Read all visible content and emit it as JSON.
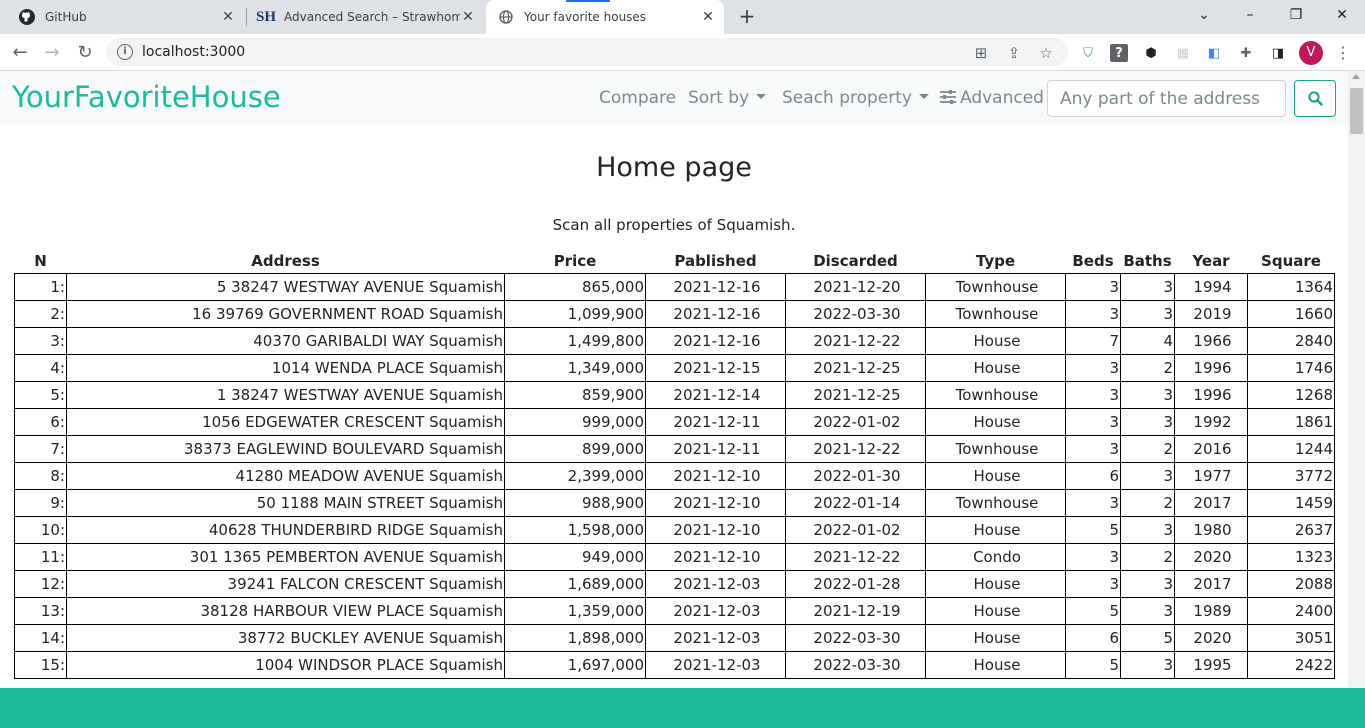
{
  "browser": {
    "tabs": [
      {
        "title": "GitHub",
        "icon": "github-icon"
      },
      {
        "title": "Advanced Search – Strawhomes.c",
        "icon": "sh-logo-icon"
      },
      {
        "title": "Your favorite houses",
        "icon": "globe-icon"
      }
    ],
    "url": "localhost:3000",
    "profile_initial": "V"
  },
  "navbar": {
    "brand": "YourFavoriteHouse",
    "compare": "Compare",
    "sort_by": "Sort by",
    "search_property": "Seach property",
    "advanced": "Advanced",
    "search_placeholder": "Any part of the address"
  },
  "page": {
    "title": "Home page",
    "subtitle": "Scan all properties of Squamish."
  },
  "table": {
    "headers": [
      "N",
      "Address",
      "Price",
      "Pablished",
      "Discarded",
      "Type",
      "Beds",
      "Baths",
      "Year",
      "Square"
    ],
    "rows": [
      [
        "1:",
        "5 38247 WESTWAY AVENUE Squamish",
        "865,000",
        "2021-12-16",
        "2021-12-20",
        "Townhouse",
        "3",
        "3",
        "1994",
        "1364"
      ],
      [
        "2:",
        "16 39769 GOVERNMENT ROAD Squamish",
        "1,099,900",
        "2021-12-16",
        "2022-03-30",
        "Townhouse",
        "3",
        "3",
        "2019",
        "1660"
      ],
      [
        "3:",
        "40370 GARIBALDI WAY Squamish",
        "1,499,800",
        "2021-12-16",
        "2021-12-22",
        "House",
        "7",
        "4",
        "1966",
        "2840"
      ],
      [
        "4:",
        "1014 WENDA PLACE Squamish",
        "1,349,000",
        "2021-12-15",
        "2021-12-25",
        "House",
        "3",
        "2",
        "1996",
        "1746"
      ],
      [
        "5:",
        "1 38247 WESTWAY AVENUE Squamish",
        "859,900",
        "2021-12-14",
        "2021-12-25",
        "Townhouse",
        "3",
        "3",
        "1996",
        "1268"
      ],
      [
        "6:",
        "1056 EDGEWATER CRESCENT Squamish",
        "999,000",
        "2021-12-11",
        "2022-01-02",
        "House",
        "3",
        "3",
        "1992",
        "1861"
      ],
      [
        "7:",
        "38373 EAGLEWIND BOULEVARD Squamish",
        "899,000",
        "2021-12-11",
        "2021-12-22",
        "Townhouse",
        "3",
        "2",
        "2016",
        "1244"
      ],
      [
        "8:",
        "41280 MEADOW AVENUE Squamish",
        "2,399,000",
        "2021-12-10",
        "2022-01-30",
        "House",
        "6",
        "3",
        "1977",
        "3772"
      ],
      [
        "9:",
        "50 1188 MAIN STREET Squamish",
        "988,900",
        "2021-12-10",
        "2022-01-14",
        "Townhouse",
        "3",
        "2",
        "2017",
        "1459"
      ],
      [
        "10:",
        "40628 THUNDERBIRD RIDGE Squamish",
        "1,598,000",
        "2021-12-10",
        "2022-01-02",
        "House",
        "5",
        "3",
        "1980",
        "2637"
      ],
      [
        "11:",
        "301 1365 PEMBERTON AVENUE Squamish",
        "949,000",
        "2021-12-10",
        "2021-12-22",
        "Condo",
        "3",
        "2",
        "2020",
        "1323"
      ],
      [
        "12:",
        "39241 FALCON CRESCENT Squamish",
        "1,689,000",
        "2021-12-03",
        "2022-01-28",
        "House",
        "3",
        "3",
        "2017",
        "2088"
      ],
      [
        "13:",
        "38128 HARBOUR VIEW PLACE Squamish",
        "1,359,000",
        "2021-12-03",
        "2021-12-19",
        "House",
        "5",
        "3",
        "1989",
        "2400"
      ],
      [
        "14:",
        "38772 BUCKLEY AVENUE Squamish",
        "1,898,000",
        "2021-12-03",
        "2022-03-30",
        "House",
        "6",
        "5",
        "2020",
        "3051"
      ],
      [
        "15:",
        "1004 WINDSOR PLACE Squamish",
        "1,697,000",
        "2021-12-03",
        "2022-03-30",
        "House",
        "5",
        "3",
        "1995",
        "2422"
      ]
    ]
  },
  "colors": {
    "brand": "#1abc9c",
    "nav_text": "#7b8a8b",
    "footer": "#1abc9c"
  }
}
